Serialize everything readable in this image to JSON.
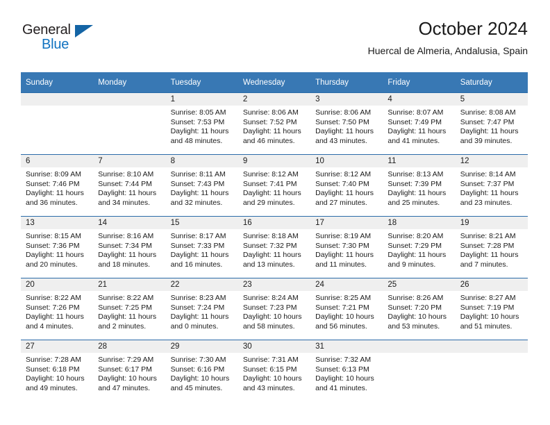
{
  "brand": {
    "name_part1": "General",
    "name_part2": "Blue",
    "color_dark": "#231f20",
    "color_blue": "#1072c0",
    "triangle_icon": "triangle-icon"
  },
  "header": {
    "title": "October 2024",
    "subtitle": "Huercal de Almeria, Andalusia, Spain"
  },
  "theme": {
    "header_bg": "#3878b4",
    "row_border": "#2a6aa8",
    "daynum_bg": "#efefef",
    "text": "#1a1a1a"
  },
  "calendar": {
    "weekday_headers": [
      "Sunday",
      "Monday",
      "Tuesday",
      "Wednesday",
      "Thursday",
      "Friday",
      "Saturday"
    ],
    "weeks": [
      [
        {
          "empty": true,
          "day": "",
          "sunrise": "",
          "sunset": "",
          "daylight_line1": "",
          "daylight_line2": ""
        },
        {
          "empty": true,
          "day": "",
          "sunrise": "",
          "sunset": "",
          "daylight_line1": "",
          "daylight_line2": ""
        },
        {
          "empty": false,
          "day": "1",
          "sunrise": "Sunrise: 8:05 AM",
          "sunset": "Sunset: 7:53 PM",
          "daylight_line1": "Daylight: 11 hours",
          "daylight_line2": "and 48 minutes."
        },
        {
          "empty": false,
          "day": "2",
          "sunrise": "Sunrise: 8:06 AM",
          "sunset": "Sunset: 7:52 PM",
          "daylight_line1": "Daylight: 11 hours",
          "daylight_line2": "and 46 minutes."
        },
        {
          "empty": false,
          "day": "3",
          "sunrise": "Sunrise: 8:06 AM",
          "sunset": "Sunset: 7:50 PM",
          "daylight_line1": "Daylight: 11 hours",
          "daylight_line2": "and 43 minutes."
        },
        {
          "empty": false,
          "day": "4",
          "sunrise": "Sunrise: 8:07 AM",
          "sunset": "Sunset: 7:49 PM",
          "daylight_line1": "Daylight: 11 hours",
          "daylight_line2": "and 41 minutes."
        },
        {
          "empty": false,
          "day": "5",
          "sunrise": "Sunrise: 8:08 AM",
          "sunset": "Sunset: 7:47 PM",
          "daylight_line1": "Daylight: 11 hours",
          "daylight_line2": "and 39 minutes."
        }
      ],
      [
        {
          "empty": false,
          "day": "6",
          "sunrise": "Sunrise: 8:09 AM",
          "sunset": "Sunset: 7:46 PM",
          "daylight_line1": "Daylight: 11 hours",
          "daylight_line2": "and 36 minutes."
        },
        {
          "empty": false,
          "day": "7",
          "sunrise": "Sunrise: 8:10 AM",
          "sunset": "Sunset: 7:44 PM",
          "daylight_line1": "Daylight: 11 hours",
          "daylight_line2": "and 34 minutes."
        },
        {
          "empty": false,
          "day": "8",
          "sunrise": "Sunrise: 8:11 AM",
          "sunset": "Sunset: 7:43 PM",
          "daylight_line1": "Daylight: 11 hours",
          "daylight_line2": "and 32 minutes."
        },
        {
          "empty": false,
          "day": "9",
          "sunrise": "Sunrise: 8:12 AM",
          "sunset": "Sunset: 7:41 PM",
          "daylight_line1": "Daylight: 11 hours",
          "daylight_line2": "and 29 minutes."
        },
        {
          "empty": false,
          "day": "10",
          "sunrise": "Sunrise: 8:12 AM",
          "sunset": "Sunset: 7:40 PM",
          "daylight_line1": "Daylight: 11 hours",
          "daylight_line2": "and 27 minutes."
        },
        {
          "empty": false,
          "day": "11",
          "sunrise": "Sunrise: 8:13 AM",
          "sunset": "Sunset: 7:39 PM",
          "daylight_line1": "Daylight: 11 hours",
          "daylight_line2": "and 25 minutes."
        },
        {
          "empty": false,
          "day": "12",
          "sunrise": "Sunrise: 8:14 AM",
          "sunset": "Sunset: 7:37 PM",
          "daylight_line1": "Daylight: 11 hours",
          "daylight_line2": "and 23 minutes."
        }
      ],
      [
        {
          "empty": false,
          "day": "13",
          "sunrise": "Sunrise: 8:15 AM",
          "sunset": "Sunset: 7:36 PM",
          "daylight_line1": "Daylight: 11 hours",
          "daylight_line2": "and 20 minutes."
        },
        {
          "empty": false,
          "day": "14",
          "sunrise": "Sunrise: 8:16 AM",
          "sunset": "Sunset: 7:34 PM",
          "daylight_line1": "Daylight: 11 hours",
          "daylight_line2": "and 18 minutes."
        },
        {
          "empty": false,
          "day": "15",
          "sunrise": "Sunrise: 8:17 AM",
          "sunset": "Sunset: 7:33 PM",
          "daylight_line1": "Daylight: 11 hours",
          "daylight_line2": "and 16 minutes."
        },
        {
          "empty": false,
          "day": "16",
          "sunrise": "Sunrise: 8:18 AM",
          "sunset": "Sunset: 7:32 PM",
          "daylight_line1": "Daylight: 11 hours",
          "daylight_line2": "and 13 minutes."
        },
        {
          "empty": false,
          "day": "17",
          "sunrise": "Sunrise: 8:19 AM",
          "sunset": "Sunset: 7:30 PM",
          "daylight_line1": "Daylight: 11 hours",
          "daylight_line2": "and 11 minutes."
        },
        {
          "empty": false,
          "day": "18",
          "sunrise": "Sunrise: 8:20 AM",
          "sunset": "Sunset: 7:29 PM",
          "daylight_line1": "Daylight: 11 hours",
          "daylight_line2": "and 9 minutes."
        },
        {
          "empty": false,
          "day": "19",
          "sunrise": "Sunrise: 8:21 AM",
          "sunset": "Sunset: 7:28 PM",
          "daylight_line1": "Daylight: 11 hours",
          "daylight_line2": "and 7 minutes."
        }
      ],
      [
        {
          "empty": false,
          "day": "20",
          "sunrise": "Sunrise: 8:22 AM",
          "sunset": "Sunset: 7:26 PM",
          "daylight_line1": "Daylight: 11 hours",
          "daylight_line2": "and 4 minutes."
        },
        {
          "empty": false,
          "day": "21",
          "sunrise": "Sunrise: 8:22 AM",
          "sunset": "Sunset: 7:25 PM",
          "daylight_line1": "Daylight: 11 hours",
          "daylight_line2": "and 2 minutes."
        },
        {
          "empty": false,
          "day": "22",
          "sunrise": "Sunrise: 8:23 AM",
          "sunset": "Sunset: 7:24 PM",
          "daylight_line1": "Daylight: 11 hours",
          "daylight_line2": "and 0 minutes."
        },
        {
          "empty": false,
          "day": "23",
          "sunrise": "Sunrise: 8:24 AM",
          "sunset": "Sunset: 7:23 PM",
          "daylight_line1": "Daylight: 10 hours",
          "daylight_line2": "and 58 minutes."
        },
        {
          "empty": false,
          "day": "24",
          "sunrise": "Sunrise: 8:25 AM",
          "sunset": "Sunset: 7:21 PM",
          "daylight_line1": "Daylight: 10 hours",
          "daylight_line2": "and 56 minutes."
        },
        {
          "empty": false,
          "day": "25",
          "sunrise": "Sunrise: 8:26 AM",
          "sunset": "Sunset: 7:20 PM",
          "daylight_line1": "Daylight: 10 hours",
          "daylight_line2": "and 53 minutes."
        },
        {
          "empty": false,
          "day": "26",
          "sunrise": "Sunrise: 8:27 AM",
          "sunset": "Sunset: 7:19 PM",
          "daylight_line1": "Daylight: 10 hours",
          "daylight_line2": "and 51 minutes."
        }
      ],
      [
        {
          "empty": false,
          "day": "27",
          "sunrise": "Sunrise: 7:28 AM",
          "sunset": "Sunset: 6:18 PM",
          "daylight_line1": "Daylight: 10 hours",
          "daylight_line2": "and 49 minutes."
        },
        {
          "empty": false,
          "day": "28",
          "sunrise": "Sunrise: 7:29 AM",
          "sunset": "Sunset: 6:17 PM",
          "daylight_line1": "Daylight: 10 hours",
          "daylight_line2": "and 47 minutes."
        },
        {
          "empty": false,
          "day": "29",
          "sunrise": "Sunrise: 7:30 AM",
          "sunset": "Sunset: 6:16 PM",
          "daylight_line1": "Daylight: 10 hours",
          "daylight_line2": "and 45 minutes."
        },
        {
          "empty": false,
          "day": "30",
          "sunrise": "Sunrise: 7:31 AM",
          "sunset": "Sunset: 6:15 PM",
          "daylight_line1": "Daylight: 10 hours",
          "daylight_line2": "and 43 minutes."
        },
        {
          "empty": false,
          "day": "31",
          "sunrise": "Sunrise: 7:32 AM",
          "sunset": "Sunset: 6:13 PM",
          "daylight_line1": "Daylight: 10 hours",
          "daylight_line2": "and 41 minutes."
        },
        {
          "empty": true,
          "day": "",
          "sunrise": "",
          "sunset": "",
          "daylight_line1": "",
          "daylight_line2": ""
        },
        {
          "empty": true,
          "day": "",
          "sunrise": "",
          "sunset": "",
          "daylight_line1": "",
          "daylight_line2": ""
        }
      ]
    ]
  }
}
